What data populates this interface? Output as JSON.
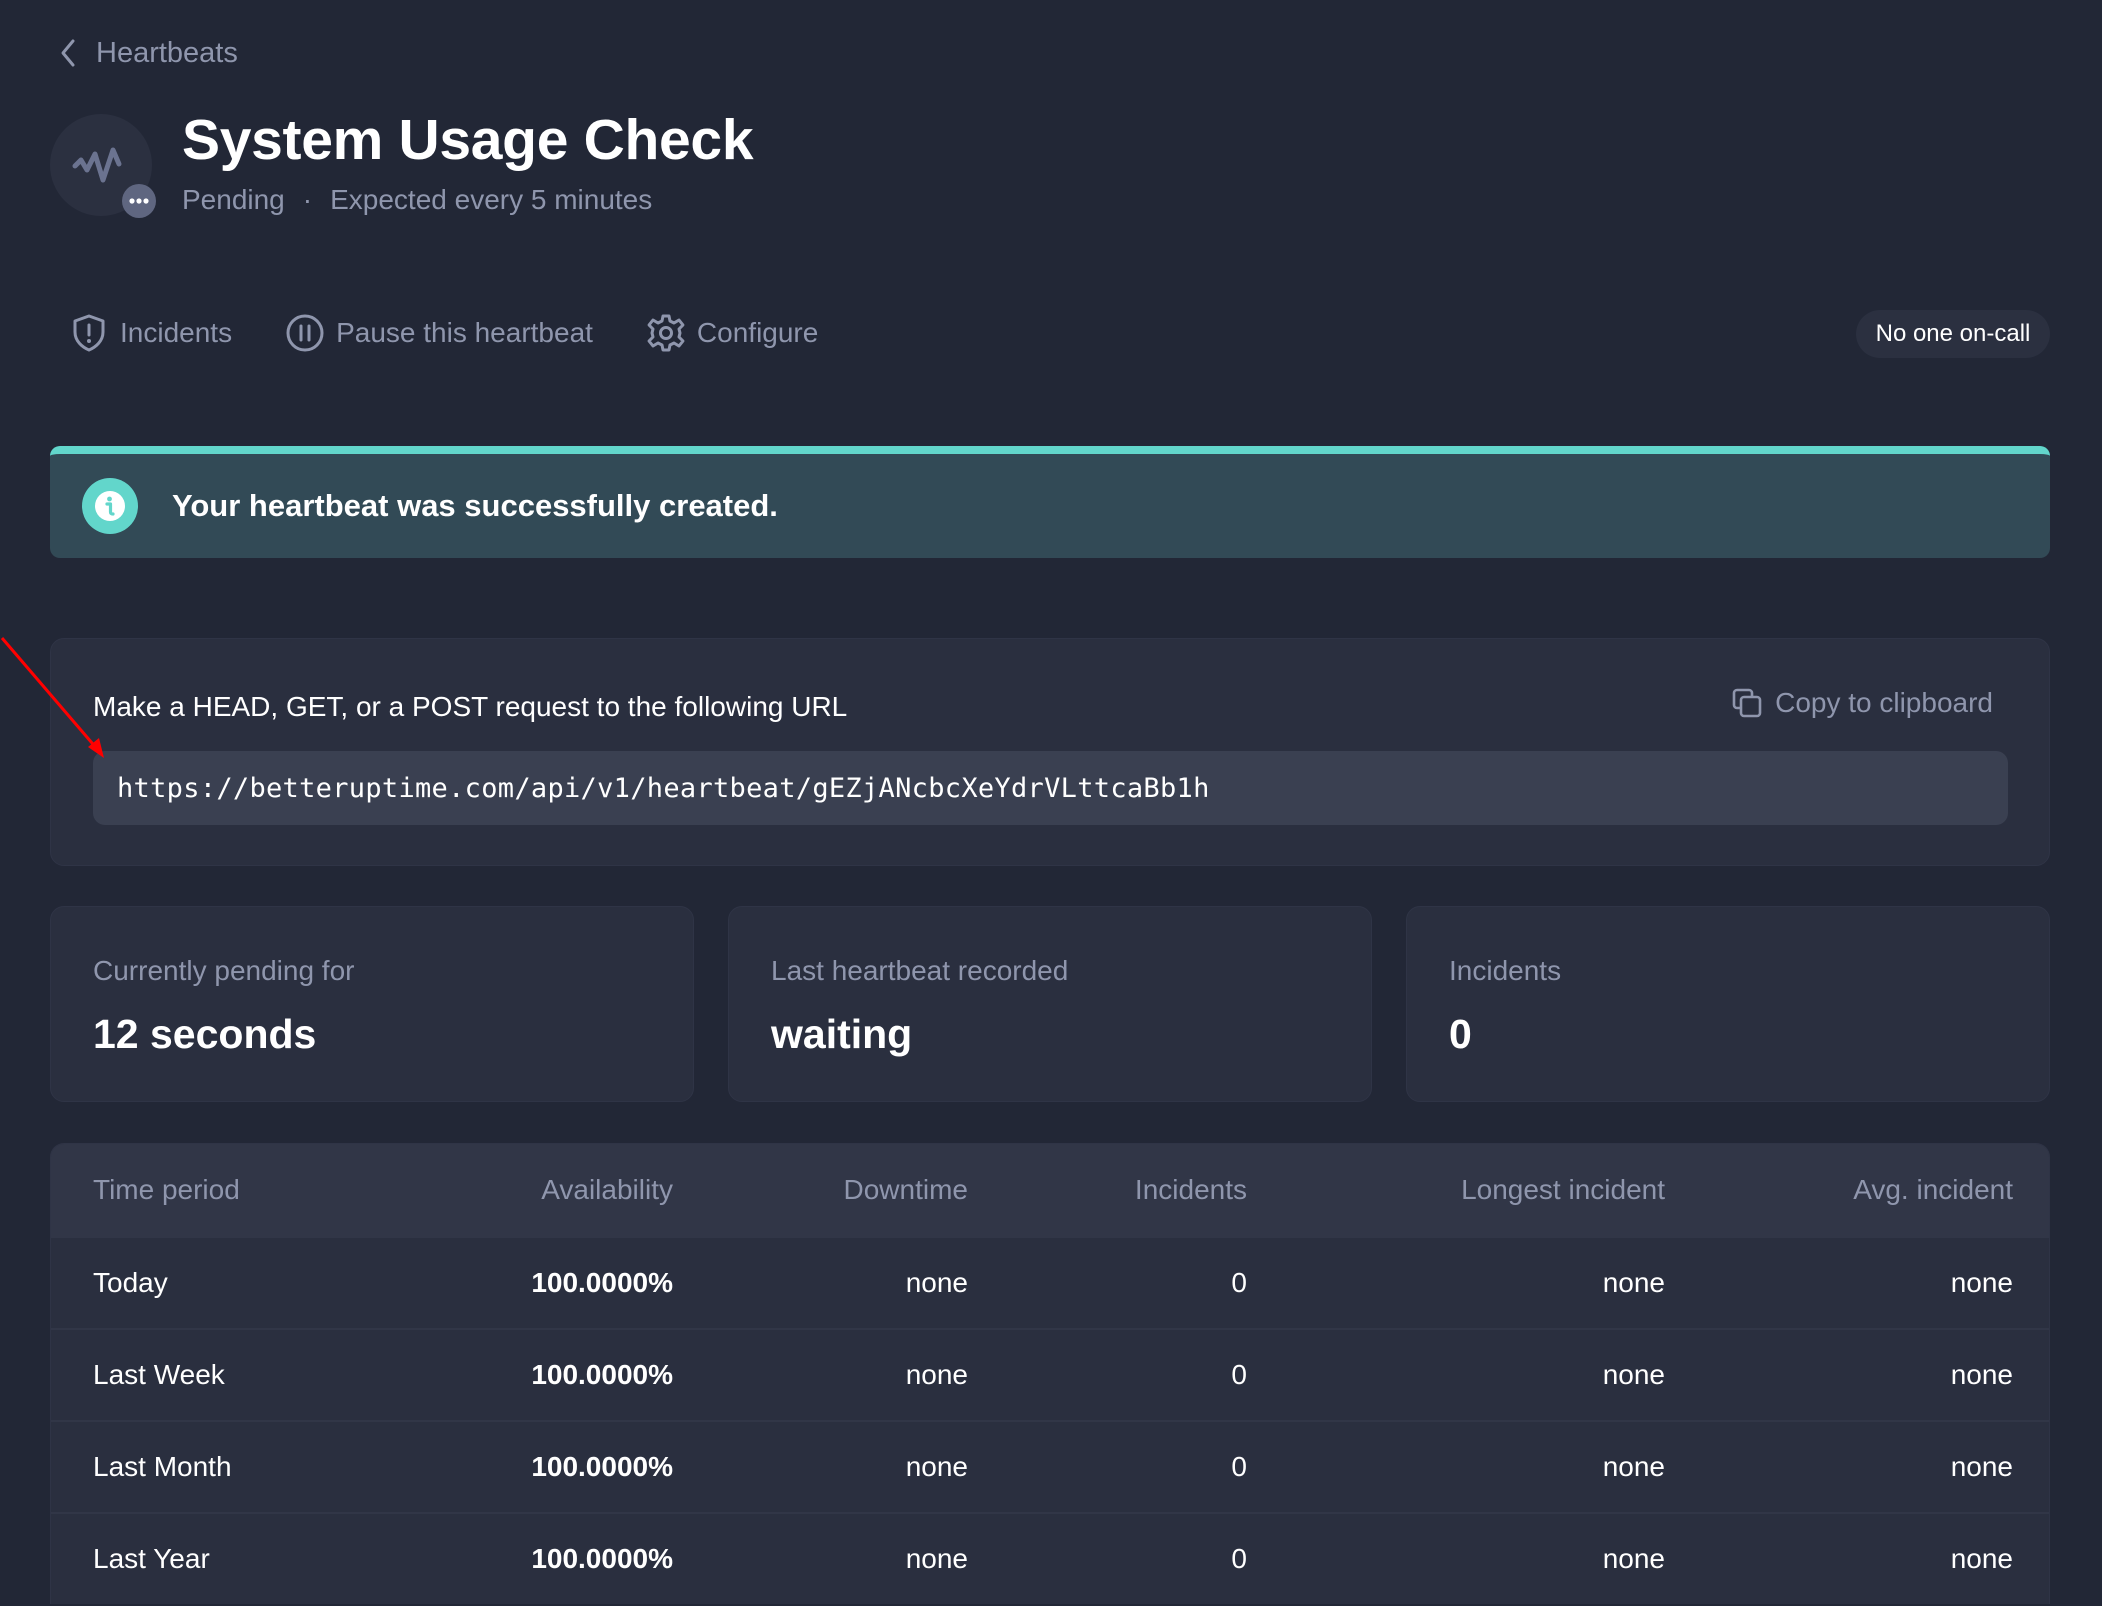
{
  "breadcrumb": {
    "back_label": "Heartbeats",
    "icon": "chevron-left-icon"
  },
  "header": {
    "title": "System Usage Check",
    "status": "Pending",
    "separator": "·",
    "schedule": "Expected every 5 minutes",
    "avatar_icon": "pulse-icon",
    "badge_icon": "more-dots-icon"
  },
  "actions": [
    {
      "label": "Incidents",
      "icon": "shield-alert-icon"
    },
    {
      "label": "Pause this heartbeat",
      "icon": "pause-circle-icon"
    },
    {
      "label": "Configure",
      "icon": "gear-icon"
    }
  ],
  "oncall": {
    "label": "No one on-call"
  },
  "banner": {
    "message": "Your heartbeat was successfully created.",
    "icon": "info-icon",
    "accent_color": "#62d6cb"
  },
  "url_card": {
    "label": "Make a HEAD, GET, or a POST request to the following URL",
    "copy_label": "Copy to clipboard",
    "copy_icon": "copy-icon",
    "url": "https://betteruptime.com/api/v1/heartbeat/gEZjANcbcXeYdrVLttcaBb1h"
  },
  "stats": [
    {
      "label": "Currently pending for",
      "value": "12 seconds"
    },
    {
      "label": "Last heartbeat recorded",
      "value": "waiting"
    },
    {
      "label": "Incidents",
      "value": "0"
    }
  ],
  "table": {
    "columns": [
      "Time period",
      "Availability",
      "Downtime",
      "Incidents",
      "Longest incident",
      "Avg. incident"
    ],
    "rows": [
      [
        "Today",
        "100.0000%",
        "none",
        "0",
        "none",
        "none"
      ],
      [
        "Last Week",
        "100.0000%",
        "none",
        "0",
        "none",
        "none"
      ],
      [
        "Last Month",
        "100.0000%",
        "none",
        "0",
        "none",
        "none"
      ],
      [
        "Last Year",
        "100.0000%",
        "none",
        "0",
        "none",
        "none"
      ]
    ]
  },
  "colors": {
    "background": "#222736",
    "card": "#2a2f3f",
    "muted_text": "#8f96ad",
    "banner_bg": "#324a56",
    "accent": "#62d6cb",
    "annotation": "#ff0000"
  }
}
